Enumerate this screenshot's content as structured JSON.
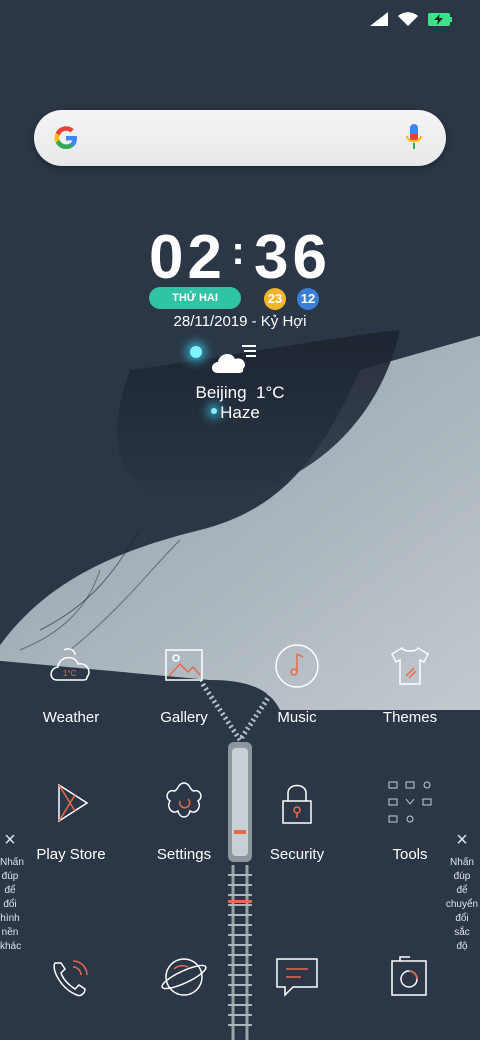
{
  "status_bar": {
    "icons": [
      "signal-icon",
      "wifi-icon",
      "battery-charging-icon"
    ],
    "battery_color": "#3de38a"
  },
  "search": {
    "logo": "google-logo",
    "mic": "mic-icon"
  },
  "clock": {
    "hours": "02",
    "separator": ":",
    "minutes": "36"
  },
  "date": {
    "weekday": "THỨ HAI",
    "badge1": "23",
    "badge2": "12",
    "lunar": "28/11/2019 - Kỷ Hợi",
    "badge1_color": "#f1b52a",
    "badge2_color": "#3a7fd6",
    "weekday_color": "#2ec4a4"
  },
  "weather": {
    "city": "Beijing",
    "temp": "1°C",
    "condition": "Haze",
    "icon": "cloud-sun-icon"
  },
  "apps": [
    {
      "label": "Weather",
      "icon": "weather-cloud-icon"
    },
    {
      "label": "Gallery",
      "icon": "gallery-image-icon"
    },
    {
      "label": "Music",
      "icon": "music-note-icon"
    },
    {
      "label": "Themes",
      "icon": "tshirt-icon"
    },
    {
      "label": "Play Store",
      "icon": "play-store-icon"
    },
    {
      "label": "Settings",
      "icon": "settings-flower-icon"
    },
    {
      "label": "Security",
      "icon": "padlock-icon"
    },
    {
      "label": "Tools",
      "icon": "tools-grid-icon"
    }
  ],
  "side_left": {
    "close": "×",
    "lines": [
      "Nhấn",
      "đúp",
      "để",
      "đổi",
      "hình",
      "nền",
      "khác"
    ]
  },
  "side_right": {
    "close": "×",
    "lines": [
      "Nhấn",
      "đúp",
      "để",
      "chuyển",
      "đổi",
      "sắc",
      "độ"
    ]
  },
  "dock": [
    "phone-icon",
    "browser-planet-icon",
    "messages-icon",
    "camera-icon"
  ],
  "accent_color": "#e86a4a"
}
